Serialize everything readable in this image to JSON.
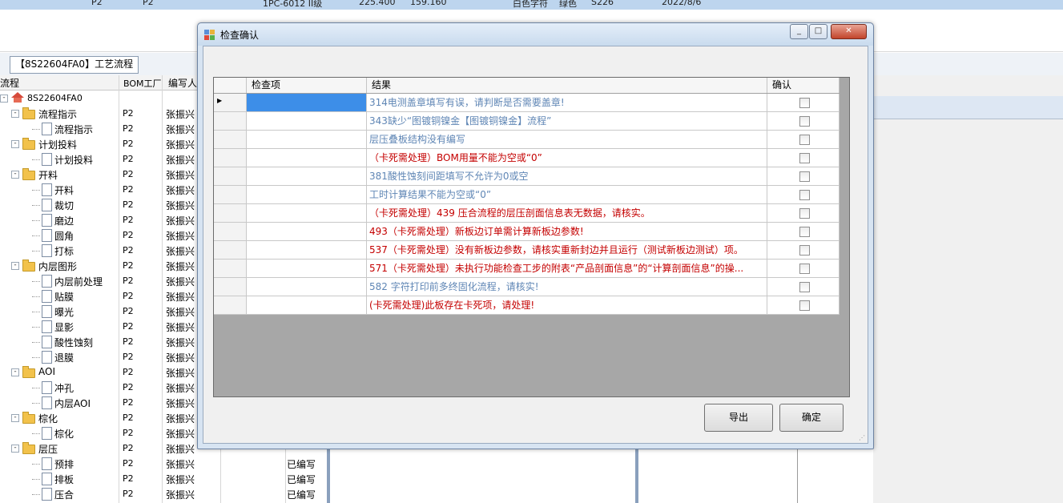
{
  "top_strip": [
    "P2",
    "P2",
    "1PC-6012 II级",
    "225.400",
    "159.160",
    "白色字符",
    "绿色",
    "S226",
    "2022/8/6"
  ],
  "tab": {
    "label": "【8S22604FA0】工艺流程"
  },
  "tree_header": {
    "process": "流程",
    "bom": "BOM工厂",
    "writer": "编写人"
  },
  "tree_rows": [
    {
      "name": "8S22604FA0",
      "factory": "",
      "writer": "",
      "status": "",
      "level": 0,
      "icon": "home-icon",
      "expander": "-"
    },
    {
      "name": "流程指示",
      "factory": "P2",
      "writer": "张振兴",
      "status": "",
      "level": 1,
      "icon": "folder-icon",
      "expander": "-"
    },
    {
      "name": "流程指示",
      "factory": "P2",
      "writer": "张振兴",
      "status": "",
      "level": 2,
      "icon": "file-icon",
      "expander": ""
    },
    {
      "name": "计划投料",
      "factory": "P2",
      "writer": "张振兴",
      "status": "",
      "level": 1,
      "icon": "folder-icon",
      "expander": "-"
    },
    {
      "name": "计划投料",
      "factory": "P2",
      "writer": "张振兴",
      "status": "",
      "level": 2,
      "icon": "file-icon",
      "expander": ""
    },
    {
      "name": "开料",
      "factory": "P2",
      "writer": "张振兴",
      "status": "",
      "level": 1,
      "icon": "folder-icon",
      "expander": "-"
    },
    {
      "name": "开料",
      "factory": "P2",
      "writer": "张振兴",
      "status": "",
      "level": 2,
      "icon": "file-icon",
      "expander": ""
    },
    {
      "name": "裁切",
      "factory": "P2",
      "writer": "张振兴",
      "status": "",
      "level": 2,
      "icon": "file-icon",
      "expander": ""
    },
    {
      "name": "磨边",
      "factory": "P2",
      "writer": "张振兴",
      "status": "",
      "level": 2,
      "icon": "file-icon",
      "expander": ""
    },
    {
      "name": "圆角",
      "factory": "P2",
      "writer": "张振兴",
      "status": "",
      "level": 2,
      "icon": "file-icon",
      "expander": ""
    },
    {
      "name": "打标",
      "factory": "P2",
      "writer": "张振兴",
      "status": "",
      "level": 2,
      "icon": "file-icon",
      "expander": ""
    },
    {
      "name": "内层图形",
      "factory": "P2",
      "writer": "张振兴",
      "status": "",
      "level": 1,
      "icon": "folder-icon",
      "expander": "-"
    },
    {
      "name": "内层前处理",
      "factory": "P2",
      "writer": "张振兴",
      "status": "",
      "level": 2,
      "icon": "file-icon",
      "expander": ""
    },
    {
      "name": "贴膜",
      "factory": "P2",
      "writer": "张振兴",
      "status": "",
      "level": 2,
      "icon": "file-icon",
      "expander": ""
    },
    {
      "name": "曝光",
      "factory": "P2",
      "writer": "张振兴",
      "status": "",
      "level": 2,
      "icon": "file-icon",
      "expander": ""
    },
    {
      "name": "显影",
      "factory": "P2",
      "writer": "张振兴",
      "status": "",
      "level": 2,
      "icon": "file-icon",
      "expander": ""
    },
    {
      "name": "酸性蚀刻",
      "factory": "P2",
      "writer": "张振兴",
      "status": "",
      "level": 2,
      "icon": "file-icon",
      "expander": ""
    },
    {
      "name": "退膜",
      "factory": "P2",
      "writer": "张振兴",
      "status": "",
      "level": 2,
      "icon": "file-icon",
      "expander": ""
    },
    {
      "name": "AOI",
      "factory": "P2",
      "writer": "张振兴",
      "status": "",
      "level": 1,
      "icon": "folder-icon",
      "expander": "-"
    },
    {
      "name": "冲孔",
      "factory": "P2",
      "writer": "张振兴",
      "status": "",
      "level": 2,
      "icon": "file-icon",
      "expander": ""
    },
    {
      "name": "内层AOI",
      "factory": "P2",
      "writer": "张振兴",
      "status": "",
      "level": 2,
      "icon": "file-icon",
      "expander": ""
    },
    {
      "name": "棕化",
      "factory": "P2",
      "writer": "张振兴",
      "status": "",
      "level": 1,
      "icon": "folder-icon",
      "expander": "-"
    },
    {
      "name": "棕化",
      "factory": "P2",
      "writer": "张振兴",
      "status": "",
      "level": 2,
      "icon": "file-icon",
      "expander": ""
    },
    {
      "name": "层压",
      "factory": "P2",
      "writer": "张振兴",
      "status": "",
      "level": 1,
      "icon": "folder-icon",
      "expander": "-"
    },
    {
      "name": "预排",
      "factory": "P2",
      "writer": "张振兴",
      "status": "已编写",
      "level": 2,
      "icon": "file-icon",
      "expander": ""
    },
    {
      "name": "排板",
      "factory": "P2",
      "writer": "张振兴",
      "status": "已编写",
      "level": 2,
      "icon": "file-icon",
      "expander": ""
    },
    {
      "name": "压合",
      "factory": "P2",
      "writer": "张振兴",
      "status": "已编写",
      "level": 2,
      "icon": "file-icon",
      "expander": ""
    }
  ],
  "dialog": {
    "title": "检查确认",
    "buttons": {
      "minimize": "_",
      "maximize": "□",
      "close": "✕"
    },
    "columns": {
      "item": "检查项",
      "result": "结果",
      "confirm": "确认"
    },
    "rows": [
      {
        "item": "",
        "result": "314电测盖章填写有误，请判断是否需要盖章!",
        "color": "blue",
        "checked": false
      },
      {
        "item": "",
        "result": "343缺少“图镀铜镍金【图镀铜镍金】流程”",
        "color": "blue",
        "checked": false
      },
      {
        "item": "",
        "result": "层压叠板结构没有编写",
        "color": "blue",
        "checked": false
      },
      {
        "item": "",
        "result": "（卡死需处理）BOM用量不能为空或“0”",
        "color": "red",
        "checked": false
      },
      {
        "item": "",
        "result": "381酸性蚀刻间距填写不允许为0或空",
        "color": "blue",
        "checked": false
      },
      {
        "item": "",
        "result": "工时计算结果不能为空或“0”",
        "color": "blue",
        "checked": false
      },
      {
        "item": "",
        "result": "（卡死需处理）439 压合流程的层压剖面信息表无数据，请核实。",
        "color": "red",
        "checked": false
      },
      {
        "item": "",
        "result": "493（卡死需处理）新板边订单需计算新板边参数!",
        "color": "red",
        "checked": false
      },
      {
        "item": "",
        "result": "537（卡死需处理）没有新板边参数，请核实重新封边并且运行（测试新板边测试）项。",
        "color": "red",
        "checked": false
      },
      {
        "item": "",
        "result": "571（卡死需处理）未执行功能检查工步的附表“产品剖面信息”的“计算剖面信息”的操...",
        "color": "red",
        "checked": false
      },
      {
        "item": "",
        "result": "582 字符打印前多终固化流程，请核实!",
        "color": "blue",
        "checked": false
      },
      {
        "item": "",
        "result": "(卡死需处理)此板存在卡死项，请处理!",
        "color": "red",
        "checked": false
      }
    ],
    "export_label": "导出",
    "ok_label": "确定"
  }
}
